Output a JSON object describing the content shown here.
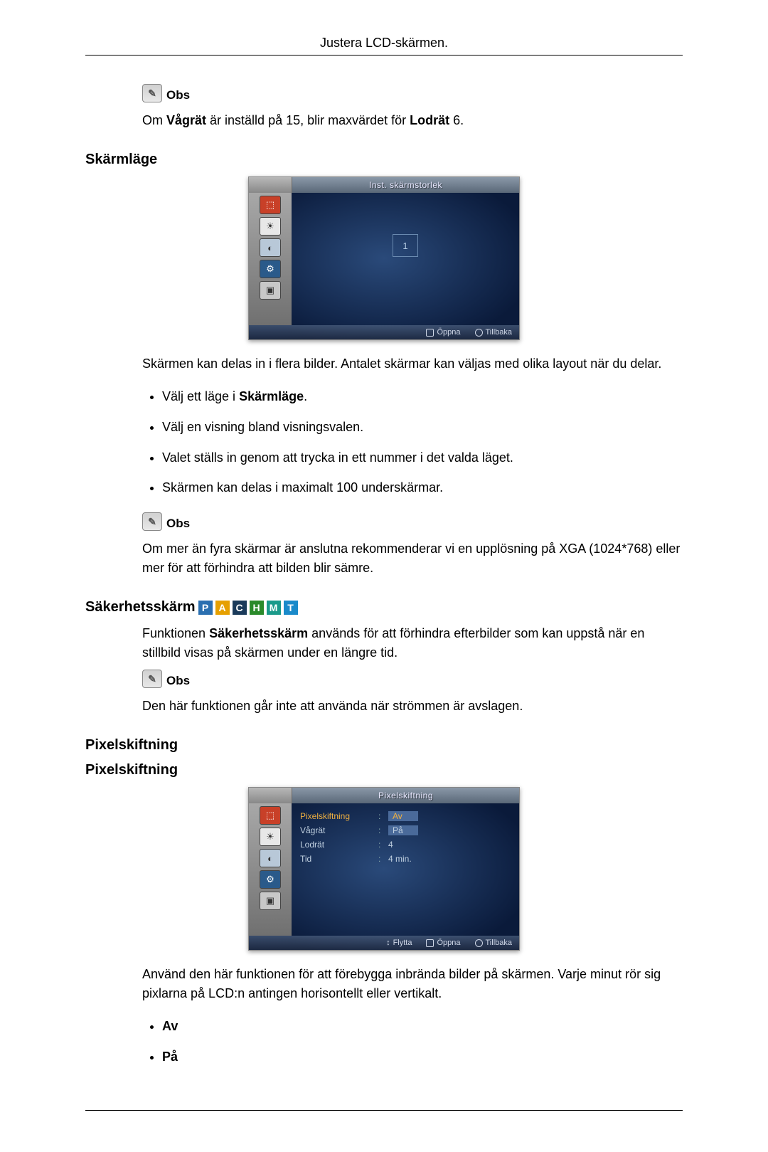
{
  "header": {
    "title": "Justera LCD-skärmen."
  },
  "note_label": "Obs",
  "sec1": {
    "note_text_pre": "Om ",
    "note_bold1": "Vågrät",
    "note_text_mid": " är inställd på 15, blir maxvärdet för ",
    "note_bold2": "Lodrät",
    "note_text_post": " 6."
  },
  "sec2": {
    "heading": "Skärmläge",
    "osd_title": "Inst. skärmstorlek",
    "osd_center": "1",
    "osd_footer_open": "Öppna",
    "osd_footer_back": "Tillbaka",
    "para": "Skärmen kan delas in i flera bilder. Antalet skärmar kan väljas med olika layout när du delar.",
    "bullets_pre1": "Välj ett läge i ",
    "bullets_bold1": "Skärmläge",
    "bullets_post1": ".",
    "bullet2": "Välj en visning bland visningsvalen.",
    "bullet3": "Valet ställs in genom att trycka in ett nummer i det valda läget.",
    "bullet4": "Skärmen kan delas i maximalt 100 underskärmar.",
    "note2": "Om mer än fyra skärmar är anslutna rekommenderar vi en upplösning på XGA (1024*768) eller mer för att förhindra att bilden blir sämre."
  },
  "sec3": {
    "heading": "Säkerhetsskärm",
    "badges": [
      "P",
      "A",
      "C",
      "H",
      "M",
      "T"
    ],
    "para_pre": "Funktionen ",
    "para_bold": "Säkerhetsskärm",
    "para_post": " används för att förhindra efterbilder som kan uppstå när en stillbild visas på skärmen under en längre tid.",
    "note": "Den här funktionen går inte att använda när strömmen är avslagen."
  },
  "sec4": {
    "heading1": "Pixelskiftning",
    "heading2": "Pixelskiftning",
    "osd_title": "Pixelskiftning",
    "rows": [
      {
        "label": "Pixelskiftning",
        "value": "Av",
        "hl": true,
        "sel": true
      },
      {
        "label": "Vågrät",
        "value": "På",
        "hl": false,
        "sel": true
      },
      {
        "label": "Lodrät",
        "value": "4",
        "hl": false,
        "sel": false
      },
      {
        "label": "Tid",
        "value": "4 min.",
        "hl": false,
        "sel": false
      }
    ],
    "osd_footer_move": "Flytta",
    "osd_footer_open": "Öppna",
    "osd_footer_back": "Tillbaka",
    "para": "Använd den här funktionen för att förebygga inbrända bilder på skärmen. Varje minut rör sig pixlarna på LCD:n antingen horisontellt eller vertikalt.",
    "bullets": [
      "Av",
      "På"
    ]
  }
}
